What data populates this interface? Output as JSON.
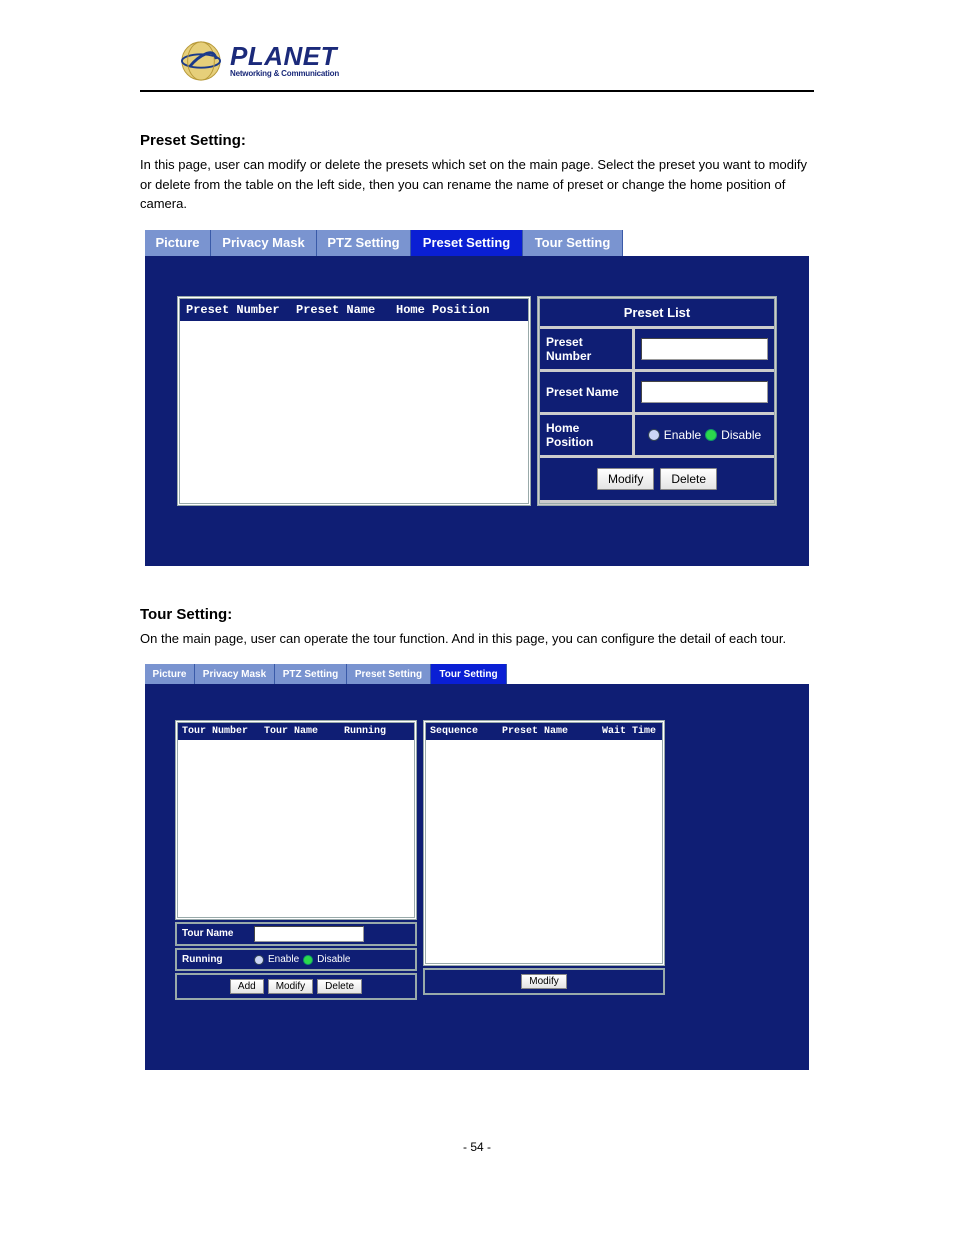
{
  "logo": {
    "brand": "PLANET",
    "tagline": "Networking & Communication"
  },
  "sections": {
    "preset": {
      "title": "Preset Setting:",
      "desc_1": "In this page, user can modify or delete the presets which set on the main page. Select the preset you want to modify or delete from the table on the left side, then you can rename the name of preset or change the home position of camera.",
      "tabs": {
        "picture": "Picture",
        "privacy": "Privacy Mask",
        "ptz": "PTZ Setting",
        "preset": "Preset Setting",
        "tour": "Tour Setting"
      },
      "table_headers": {
        "number": "Preset Number",
        "name": "Preset Name",
        "home": "Home Position"
      },
      "list": {
        "header": "Preset List",
        "number_label": "Preset Number",
        "name_label": "Preset Name",
        "home_label": "Home Position",
        "enable": "Enable",
        "disable": "Disable",
        "modify_btn": "Modify",
        "delete_btn": "Delete"
      }
    },
    "tour": {
      "title": "Tour Setting:",
      "desc_1": "On the main page, user can operate the tour function. And in this page, you can configure the detail of each tour.",
      "tabs": {
        "picture": "Picture",
        "privacy": "Privacy Mask",
        "ptz": "PTZ Setting",
        "preset": "Preset Setting",
        "tour": "Tour Setting"
      },
      "left_headers": {
        "number": "Tour Number",
        "name": "Tour Name",
        "running": "Running"
      },
      "right_headers": {
        "sequence": "Sequence",
        "preset": "Preset Name",
        "wait": "Wait Time"
      },
      "form": {
        "tour_name_label": "Tour Name",
        "running_label": "Running",
        "enable": "Enable",
        "disable": "Disable",
        "add_btn": "Add",
        "modify_btn": "Modify",
        "delete_btn": "Delete"
      },
      "right_modify_btn": "Modify"
    }
  },
  "footer": "- 54 -"
}
